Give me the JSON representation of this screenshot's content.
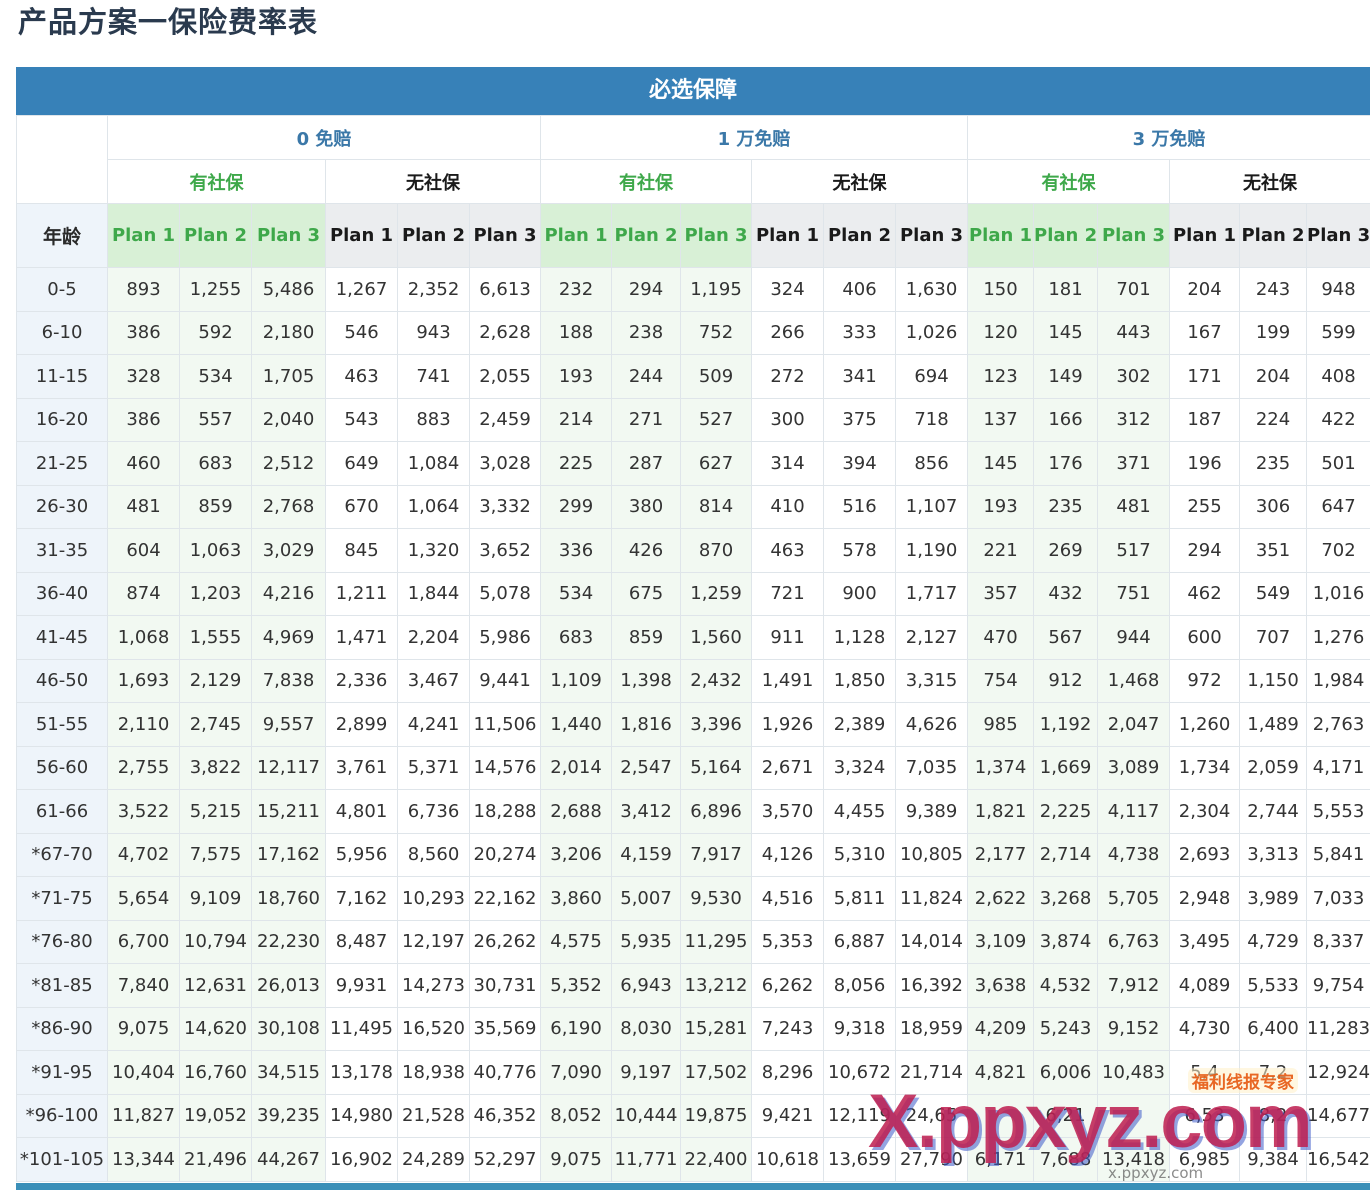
{
  "page": {
    "title": "产品方案一保险费率表"
  },
  "table": {
    "band_title": "必选保障",
    "age_header": "年龄",
    "deductibles": [
      "0 免赔",
      "1 万免赔",
      "3 万免赔"
    ],
    "insurance_types": [
      "有社保",
      "无社保"
    ],
    "plans": [
      "Plan 1",
      "Plan 2",
      "Plan 3"
    ],
    "rows": [
      {
        "age": "0-5",
        "values": [
          "893",
          "1,255",
          "5,486",
          "1,267",
          "2,352",
          "6,613",
          "232",
          "294",
          "1,195",
          "324",
          "406",
          "1,630",
          "150",
          "181",
          "701",
          "204",
          "243",
          "948"
        ]
      },
      {
        "age": "6-10",
        "values": [
          "386",
          "592",
          "2,180",
          "546",
          "943",
          "2,628",
          "188",
          "238",
          "752",
          "266",
          "333",
          "1,026",
          "120",
          "145",
          "443",
          "167",
          "199",
          "599"
        ]
      },
      {
        "age": "11-15",
        "values": [
          "328",
          "534",
          "1,705",
          "463",
          "741",
          "2,055",
          "193",
          "244",
          "509",
          "272",
          "341",
          "694",
          "123",
          "149",
          "302",
          "171",
          "204",
          "408"
        ]
      },
      {
        "age": "16-20",
        "values": [
          "386",
          "557",
          "2,040",
          "543",
          "883",
          "2,459",
          "214",
          "271",
          "527",
          "300",
          "375",
          "718",
          "137",
          "166",
          "312",
          "187",
          "224",
          "422"
        ]
      },
      {
        "age": "21-25",
        "values": [
          "460",
          "683",
          "2,512",
          "649",
          "1,084",
          "3,028",
          "225",
          "287",
          "627",
          "314",
          "394",
          "856",
          "145",
          "176",
          "371",
          "196",
          "235",
          "501"
        ]
      },
      {
        "age": "26-30",
        "values": [
          "481",
          "859",
          "2,768",
          "670",
          "1,064",
          "3,332",
          "299",
          "380",
          "814",
          "410",
          "516",
          "1,107",
          "193",
          "235",
          "481",
          "255",
          "306",
          "647"
        ]
      },
      {
        "age": "31-35",
        "values": [
          "604",
          "1,063",
          "3,029",
          "845",
          "1,320",
          "3,652",
          "336",
          "426",
          "870",
          "463",
          "578",
          "1,190",
          "221",
          "269",
          "517",
          "294",
          "351",
          "702"
        ]
      },
      {
        "age": "36-40",
        "values": [
          "874",
          "1,203",
          "4,216",
          "1,211",
          "1,844",
          "5,078",
          "534",
          "675",
          "1,259",
          "721",
          "900",
          "1,717",
          "357",
          "432",
          "751",
          "462",
          "549",
          "1,016"
        ]
      },
      {
        "age": "41-45",
        "values": [
          "1,068",
          "1,555",
          "4,969",
          "1,471",
          "2,204",
          "5,986",
          "683",
          "859",
          "1,560",
          "911",
          "1,128",
          "2,127",
          "470",
          "567",
          "944",
          "600",
          "707",
          "1,276"
        ]
      },
      {
        "age": "46-50",
        "values": [
          "1,693",
          "2,129",
          "7,838",
          "2,336",
          "3,467",
          "9,441",
          "1,109",
          "1,398",
          "2,432",
          "1,491",
          "1,850",
          "3,315",
          "754",
          "912",
          "1,468",
          "972",
          "1,150",
          "1,984"
        ]
      },
      {
        "age": "51-55",
        "values": [
          "2,110",
          "2,745",
          "9,557",
          "2,899",
          "4,241",
          "11,506",
          "1,440",
          "1,816",
          "3,396",
          "1,926",
          "2,389",
          "4,626",
          "985",
          "1,192",
          "2,047",
          "1,260",
          "1,489",
          "2,763"
        ]
      },
      {
        "age": "56-60",
        "values": [
          "2,755",
          "3,822",
          "12,117",
          "3,761",
          "5,371",
          "14,576",
          "2,014",
          "2,547",
          "5,164",
          "2,671",
          "3,324",
          "7,035",
          "1,374",
          "1,669",
          "3,089",
          "1,734",
          "2,059",
          "4,171"
        ]
      },
      {
        "age": "61-66",
        "values": [
          "3,522",
          "5,215",
          "15,211",
          "4,801",
          "6,736",
          "18,288",
          "2,688",
          "3,412",
          "6,896",
          "3,570",
          "4,455",
          "9,389",
          "1,821",
          "2,225",
          "4,117",
          "2,304",
          "2,744",
          "5,553"
        ]
      },
      {
        "age": "*67-70",
        "values": [
          "4,702",
          "7,575",
          "17,162",
          "5,956",
          "8,560",
          "20,274",
          "3,206",
          "4,159",
          "7,917",
          "4,126",
          "5,310",
          "10,805",
          "2,177",
          "2,714",
          "4,738",
          "2,693",
          "3,313",
          "5,841"
        ]
      },
      {
        "age": "*71-75",
        "values": [
          "5,654",
          "9,109",
          "18,760",
          "7,162",
          "10,293",
          "22,162",
          "3,860",
          "5,007",
          "9,530",
          "4,516",
          "5,811",
          "11,824",
          "2,622",
          "3,268",
          "5,705",
          "2,948",
          "3,989",
          "7,033"
        ]
      },
      {
        "age": "*76-80",
        "values": [
          "6,700",
          "10,794",
          "22,230",
          "8,487",
          "12,197",
          "26,262",
          "4,575",
          "5,935",
          "11,295",
          "5,353",
          "6,887",
          "14,014",
          "3,109",
          "3,874",
          "6,763",
          "3,495",
          "4,729",
          "8,337"
        ]
      },
      {
        "age": "*81-85",
        "values": [
          "7,840",
          "12,631",
          "26,013",
          "9,931",
          "14,273",
          "30,731",
          "5,352",
          "6,943",
          "13,212",
          "6,262",
          "8,056",
          "16,392",
          "3,638",
          "4,532",
          "7,912",
          "4,089",
          "5,533",
          "9,754"
        ]
      },
      {
        "age": "*86-90",
        "values": [
          "9,075",
          "14,620",
          "30,108",
          "11,495",
          "16,520",
          "35,569",
          "6,190",
          "8,030",
          "15,281",
          "7,243",
          "9,318",
          "18,959",
          "4,209",
          "5,243",
          "9,152",
          "4,730",
          "6,400",
          "11,283"
        ]
      },
      {
        "age": "*91-95",
        "values": [
          "10,404",
          "16,760",
          "34,515",
          "13,178",
          "18,938",
          "40,776",
          "7,090",
          "9,197",
          "17,502",
          "8,296",
          "10,672",
          "21,714",
          "4,821",
          "6,006",
          "10,483",
          "5,4",
          "7,2",
          "12,924"
        ]
      },
      {
        "age": "*96-100",
        "values": [
          "11,827",
          "19,052",
          "39,235",
          "14,980",
          "21,528",
          "46,352",
          "8,052",
          "10,444",
          "19,875",
          "9,421",
          "12,119",
          "24,65",
          "",
          "6,21",
          "",
          "6,53",
          "8,2",
          "14,677"
        ]
      },
      {
        "age": "*101-105",
        "values": [
          "13,344",
          "21,496",
          "44,267",
          "16,902",
          "24,289",
          "52,297",
          "9,075",
          "11,771",
          "22,400",
          "10,618",
          "13,659",
          "27,790",
          "6,171",
          "7,688",
          "13,418",
          "6,985",
          "9,384",
          "16,542"
        ]
      }
    ]
  },
  "watermark": {
    "text": "X.ppxyz.com",
    "sub": "x.ppxyz.com",
    "badge": "福利线报专家"
  }
}
